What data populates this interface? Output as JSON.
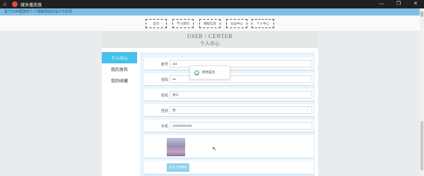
{
  "window": {
    "title": "媒体播放器"
  },
  "banner": {
    "tagline": "基于SSM框架的个人博客网站的设计与实现"
  },
  "nav": [
    "首页",
    "学习资料",
    "课程信息",
    "论坛中心",
    "个人中心"
  ],
  "header": {
    "title_en": "USER / CENTER",
    "title_cn": "个人中心"
  },
  "sidebar": [
    {
      "label": "个人中心",
      "active": true
    },
    {
      "label": "我的发布",
      "active": false
    },
    {
      "label": "我的收藏",
      "active": false
    }
  ],
  "form": {
    "fields": [
      {
        "label": "账号",
        "value": "111"
      },
      {
        "label": "密码",
        "value": "•••"
      },
      {
        "label": "姓名",
        "value": "张三"
      },
      {
        "label": "性别",
        "value": "男"
      },
      {
        "label": "手机",
        "value": "13154541454"
      }
    ],
    "upload_label": "点击上传照片"
  },
  "toast": {
    "message": "修改成功"
  }
}
